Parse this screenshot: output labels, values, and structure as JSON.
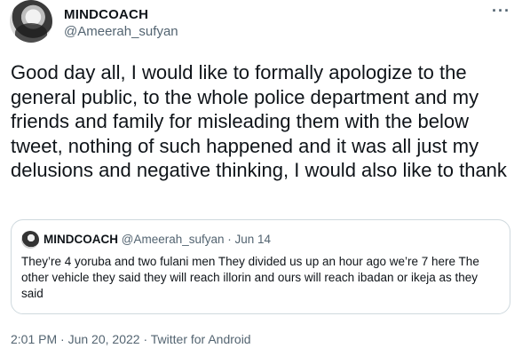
{
  "author": {
    "name": "MINDCOACH",
    "handle": "@Ameerah_sufyan"
  },
  "more_icon": "more-horizontal-icon",
  "tweet_text": "Good day all, I would like to formally apologize to the general public, to the whole police department and my friends and family for misleading them with the below tweet, nothing of such happened and it was all just my delusions and negative thinking, I would also like to thank",
  "quoted": {
    "name": "MINDCOACH",
    "meta": "@Ameerah_sufyan · Jun 14",
    "text": "They’re 4 yoruba and two fulani men They divided us up an hour ago we’re 7 here The other vehicle they said they will reach illorin and ours will reach ibadan or ikeja as they said"
  },
  "footer": {
    "time": "2:01 PM",
    "sep1": " · ",
    "date": "Jun 20, 2022",
    "sep2": " · ",
    "source": "Twitter for Android"
  },
  "colors": {
    "text": "#0f1419",
    "secondary": "#536471",
    "border": "#cfd9de"
  }
}
